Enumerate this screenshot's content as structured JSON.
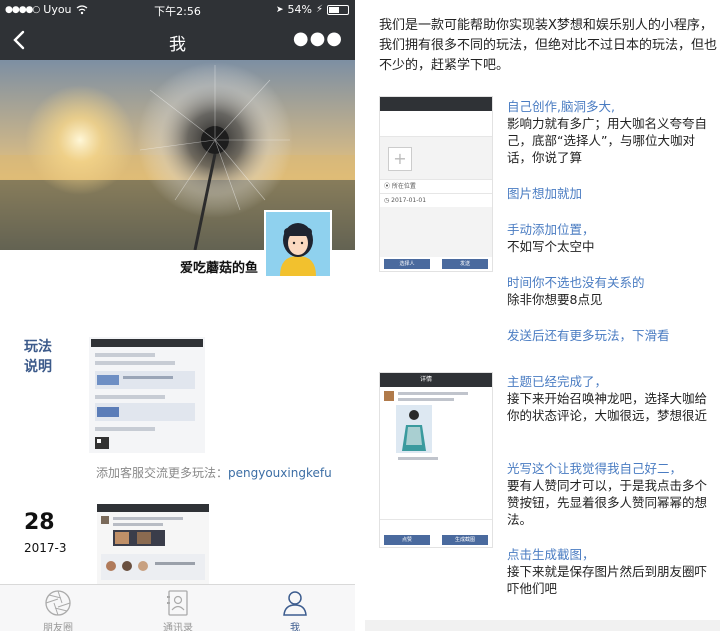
{
  "status_bar": {
    "carrier": "Uyou",
    "time": "下午2:56",
    "battery": "54%"
  },
  "nav": {
    "title": "我"
  },
  "profile": {
    "nickname": "爱吃蘑菇的鱼"
  },
  "posts": [
    {
      "label": "玩法说明",
      "caption_prefix": "添加客服交流更多玩法：",
      "caption_id": "pengyouxingkefu"
    },
    {
      "day": "28",
      "month": "2017-3"
    }
  ],
  "tabbar": [
    {
      "label": "朋友圈",
      "icon": "aperture-icon"
    },
    {
      "label": "通讯录",
      "icon": "contacts-icon"
    },
    {
      "label": "我",
      "icon": "person-icon"
    }
  ],
  "panel": {
    "intro": "我们是一款可能帮助你实现装X梦想和娱乐别人的小程序，我们拥有很多不同的玩法，但绝对比不过日本的玩法，但也不少的，赶紧学下吧。",
    "shot1": {
      "location": "所在位置",
      "date": "2017-01-01",
      "btn_left": "选择人",
      "btn_right": "发送"
    },
    "shot2": {
      "title": "详情",
      "btn_left": "点赞",
      "btn_right": "生成截图"
    },
    "annotations": [
      {
        "heading": "自己创作,脑洞多大,",
        "body": "影响力就有多广；用大咖名义夸夸自己，底部“选择人”，与哪位大咖对话，你说了算"
      },
      {
        "heading": "图片想加就加",
        "body": ""
      },
      {
        "heading": "手动添加位置，",
        "body": "不如写个太空中"
      },
      {
        "heading": "时间你不选也没有关系的",
        "body": "除非你想要8点见"
      },
      {
        "heading": "发送后还有更多玩法，下滑看",
        "body": ""
      },
      {
        "heading": "主题已经完成了，",
        "body": "接下来开始召唤神龙吧，选择大咖给你的状态评论，大咖很远，梦想很近"
      },
      {
        "heading": "光写这个让我觉得我自己好二，",
        "body": "要有人赞同才可以，于是我点击多个赞按钮，先显着很多人赞同幂幂的想法。"
      },
      {
        "heading": "点击生成截图，",
        "body": "接下来就是保存图片然后到朋友圈吓吓他们吧"
      }
    ]
  },
  "colors": {
    "nav_bg": "#2f3236",
    "link_blue": "#3c6ea5",
    "heading_blue": "#4a7cc2"
  }
}
